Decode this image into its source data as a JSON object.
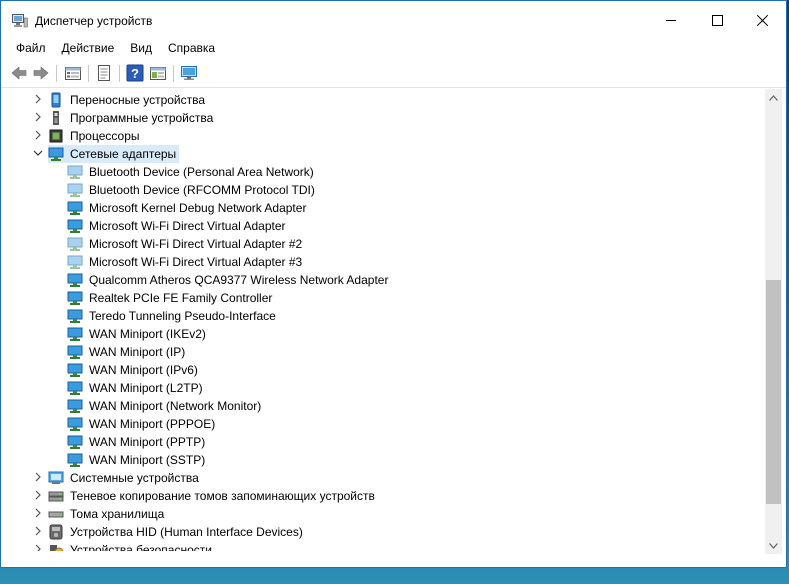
{
  "window": {
    "title": "Диспетчер устройств"
  },
  "menu": [
    "Файл",
    "Действие",
    "Вид",
    "Справка"
  ],
  "toolbar": {
    "buttons": [
      "back-icon",
      "forward-icon",
      "properties-list-icon",
      "document-icon",
      "help-icon",
      "view-icon",
      "monitor-icon"
    ]
  },
  "tree": {
    "categories_top": [
      {
        "label": "Переносные устройства",
        "icon": "portable-device-icon"
      },
      {
        "label": "Программные устройства",
        "icon": "software-device-icon"
      },
      {
        "label": "Процессоры",
        "icon": "processor-icon"
      }
    ],
    "expanded_category": {
      "label": "Сетевые адаптеры",
      "icon": "network-adapter-icon",
      "selected": true
    },
    "adapters": [
      {
        "label": "Bluetooth Device (Personal Area Network)",
        "disabled": true
      },
      {
        "label": "Bluetooth Device (RFCOMM Protocol TDI)",
        "disabled": true
      },
      {
        "label": "Microsoft Kernel Debug Network Adapter",
        "disabled": false
      },
      {
        "label": "Microsoft Wi-Fi Direct Virtual Adapter",
        "disabled": false
      },
      {
        "label": "Microsoft Wi-Fi Direct Virtual Adapter #2",
        "disabled": true
      },
      {
        "label": "Microsoft Wi-Fi Direct Virtual Adapter #3",
        "disabled": true
      },
      {
        "label": "Qualcomm Atheros QCA9377 Wireless Network Adapter",
        "disabled": false
      },
      {
        "label": "Realtek PCIe FE Family Controller",
        "disabled": false
      },
      {
        "label": "Teredo Tunneling Pseudo-Interface",
        "disabled": false
      },
      {
        "label": "WAN Miniport (IKEv2)",
        "disabled": false
      },
      {
        "label": "WAN Miniport (IP)",
        "disabled": false
      },
      {
        "label": "WAN Miniport (IPv6)",
        "disabled": false
      },
      {
        "label": "WAN Miniport (L2TP)",
        "disabled": false
      },
      {
        "label": "WAN Miniport (Network Monitor)",
        "disabled": false
      },
      {
        "label": "WAN Miniport (PPPOE)",
        "disabled": false
      },
      {
        "label": "WAN Miniport (PPTP)",
        "disabled": false
      },
      {
        "label": "WAN Miniport (SSTP)",
        "disabled": false
      }
    ],
    "categories_bottom": [
      {
        "label": "Системные устройства",
        "icon": "system-device-icon"
      },
      {
        "label": "Теневое копирование томов запоминающих устройств",
        "icon": "volume-shadow-icon"
      },
      {
        "label": "Тома хранилища",
        "icon": "storage-volume-icon"
      },
      {
        "label": "Устройства HID (Human Interface Devices)",
        "icon": "hid-icon"
      },
      {
        "label": "Устройства безопасности",
        "icon": "security-device-icon"
      }
    ]
  }
}
